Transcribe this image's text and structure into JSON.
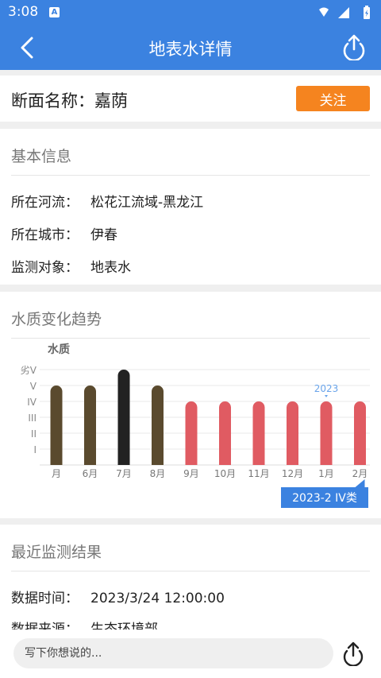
{
  "status_bar": {
    "time": "3:08",
    "notif_letter": "A"
  },
  "header": {
    "title": "地表水详情",
    "back_icon": "chevron-left-icon",
    "share_icon": "share-upload-icon"
  },
  "section": {
    "label": "断面名称：嘉荫",
    "follow_label": "关注",
    "follow_color": "#f5841f"
  },
  "basic_info": {
    "title": "基本信息",
    "rows": [
      {
        "key": "所在河流：",
        "value": "松花江流域-黑龙江"
      },
      {
        "key": "所在城市：",
        "value": "伊春"
      },
      {
        "key": "监测对象：",
        "value": "地表水"
      }
    ]
  },
  "trend": {
    "title": "水质变化趋势",
    "tooltip": "2023-2 IV类",
    "year_marker": "2023"
  },
  "chart_data": {
    "type": "bar",
    "ylabel": "水质",
    "y_ticks": [
      "I",
      "II",
      "III",
      "IV",
      "V",
      "劣V"
    ],
    "categories": [
      "月",
      "6月",
      "7月",
      "8月",
      "9月",
      "10月",
      "11月",
      "12月",
      "1月",
      "2月"
    ],
    "values": [
      5,
      5,
      6,
      5,
      4,
      4,
      4,
      4,
      4,
      4
    ],
    "colors": [
      "#5a4a2e",
      "#5a4a2e",
      "#222222",
      "#5a4a2e",
      "#e05b62",
      "#e05b62",
      "#e05b62",
      "#e05b62",
      "#e05b62",
      "#e05b62"
    ],
    "ylim": [
      0,
      6
    ],
    "highlight": "2月"
  },
  "recent": {
    "title": "最近监测结果",
    "rows": [
      {
        "key": "数据时间：",
        "value": "2023/3/24 12:00:00"
      },
      {
        "key": "数据来源：",
        "value": "生态环境部"
      }
    ]
  },
  "comment": {
    "placeholder": "写下你想说的..."
  }
}
